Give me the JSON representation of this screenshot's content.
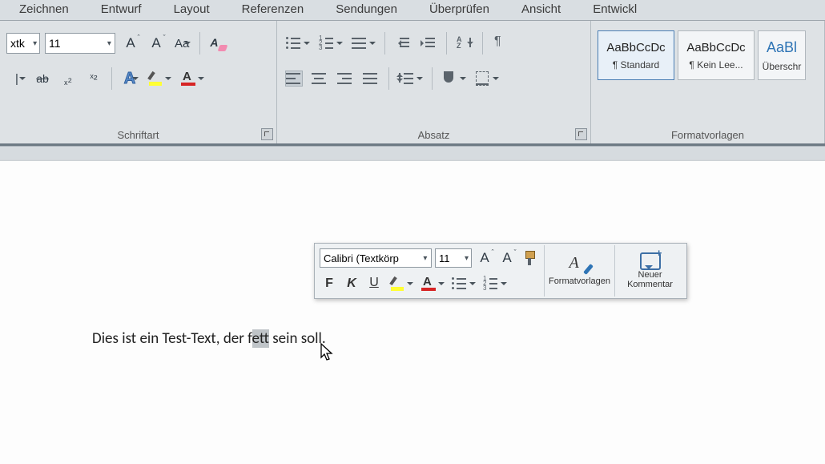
{
  "tabs": {
    "zeichnen": "Zeichnen",
    "entwurf": "Entwurf",
    "layout": "Layout",
    "referenzen": "Referenzen",
    "sendungen": "Sendungen",
    "ueberpruefen": "Überprüfen",
    "ansicht": "Ansicht",
    "entwickler": "Entwickl"
  },
  "ribbon": {
    "font": {
      "label": "Schriftart",
      "name_value": "xtk",
      "size_value": "11",
      "grow": "A",
      "shrink": "A",
      "changecase": "Aa",
      "strike": "ab",
      "sub": "x",
      "sup": "x"
    },
    "paragraph": {
      "label": "Absatz"
    },
    "styles": {
      "label": "Formatvorlagen",
      "items": [
        {
          "preview": "AaBbCcDc",
          "name": "¶ Standard",
          "selected": true,
          "heading": false
        },
        {
          "preview": "AaBbCcDc",
          "name": "¶ Kein Lee...",
          "selected": false,
          "heading": false
        },
        {
          "preview": "AaBl",
          "name": "Überschr",
          "selected": false,
          "heading": true
        }
      ]
    }
  },
  "mini": {
    "font_name": "Calibri (Textkörp",
    "font_size": "11",
    "grow": "A",
    "shrink": "A",
    "bold": "F",
    "italic": "K",
    "underline": "U",
    "styles_label": "Formatvorlagen",
    "comment_label": "Neuer Kommentar"
  },
  "document": {
    "before": "Dies ist ein Test-Text, der f",
    "selected": "et",
    "after": "t sein soll."
  }
}
